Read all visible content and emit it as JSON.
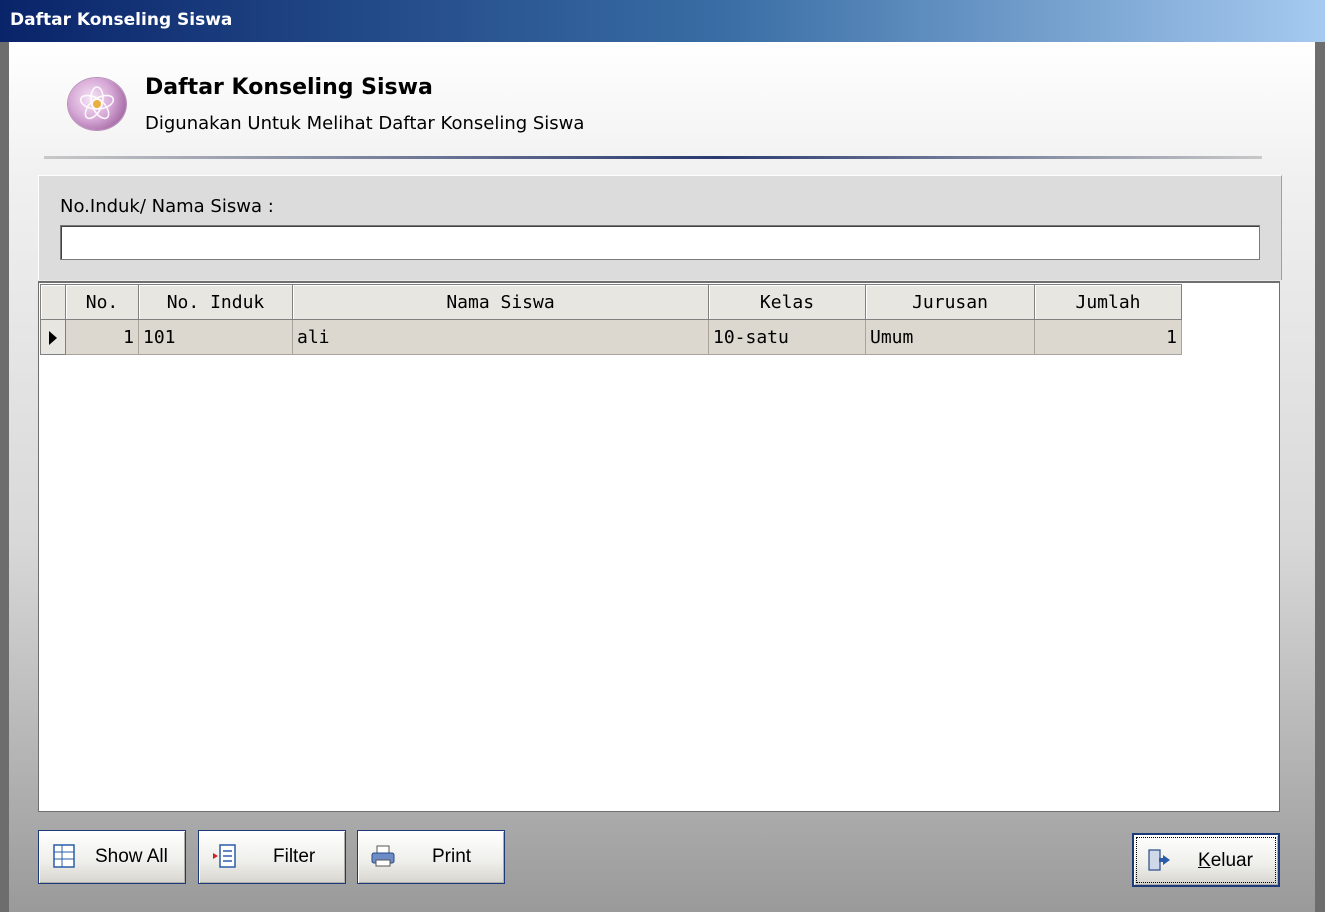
{
  "window": {
    "title": "Daftar Konseling Siswa"
  },
  "header": {
    "title": "Daftar Konseling Siswa",
    "subtitle": "Digunakan Untuk Melihat Daftar Konseling Siswa",
    "logo_icon": "flower-orb-icon"
  },
  "filter": {
    "label": "No.Induk/ Nama Siswa :",
    "value": ""
  },
  "grid": {
    "columns": [
      "No.",
      "No. Induk",
      "Nama Siswa",
      "Kelas",
      "Jurusan",
      "Jumlah"
    ],
    "rows": [
      {
        "no": "1",
        "no_induk": "101",
        "nama": "ali",
        "kelas": "10-satu",
        "jurusan": "Umum",
        "jumlah": "1"
      }
    ],
    "row_indicator_icon": "current-row-arrow-icon"
  },
  "buttons": {
    "show_all": "Show All",
    "filter": "Filter",
    "print": "Print",
    "keluar": "Keluar"
  },
  "colors": {
    "titlebar_start": "#0a246a",
    "titlebar_end": "#a6caf0",
    "grid_row_bg": "#dcd8d0"
  }
}
